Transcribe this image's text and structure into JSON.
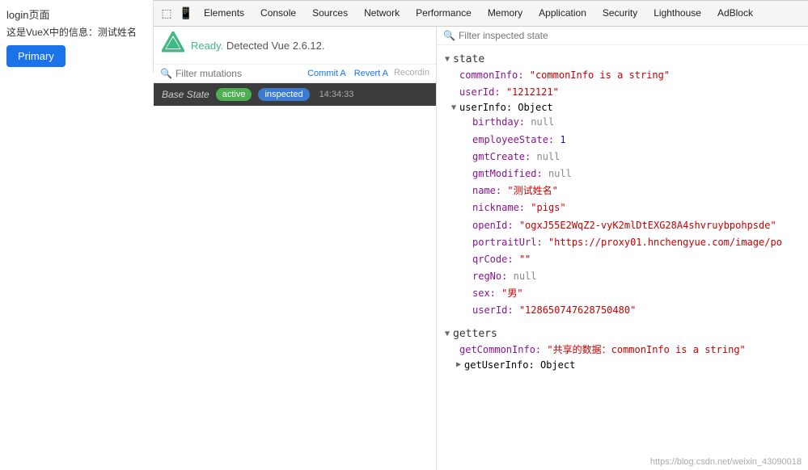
{
  "page": {
    "title": "login页面",
    "info": "这是VueX中的信息：测试姓名",
    "primary_btn": "Primary"
  },
  "devtools": {
    "tabs": [
      {
        "label": "Elements"
      },
      {
        "label": "Console"
      },
      {
        "label": "Sources"
      },
      {
        "label": "Network"
      },
      {
        "label": "Performance"
      },
      {
        "label": "Memory"
      },
      {
        "label": "Application"
      },
      {
        "label": "Security"
      },
      {
        "label": "Lighthouse"
      },
      {
        "label": "AdBlock"
      }
    ]
  },
  "vue": {
    "logo": "▶",
    "ready_text": "Ready. Detected Vue 2.6.12."
  },
  "mutations": {
    "filter_placeholder": "Filter mutations",
    "commit_label": "Commit A",
    "revert_label": "Revert A",
    "recording_label": "Recordin"
  },
  "state_bar": {
    "base_label": "Base State",
    "active_badge": "active",
    "inspected_badge": "inspected",
    "time": "14:34:33"
  },
  "right_panel": {
    "filter_placeholder": "Filter inspected state",
    "state_section": "state",
    "getters_section": "getters",
    "state_items": [
      {
        "key": "commonInfo:",
        "value": "\"commonInfo is a string\"",
        "type": "string"
      },
      {
        "key": "userId:",
        "value": "\"1212121\"",
        "type": "string"
      }
    ],
    "user_info": {
      "label": "userInfo: Object",
      "birthday": "null",
      "employeeState": "1",
      "gmtCreate": "null",
      "gmtModified": "null",
      "name": "\"测试姓名\"",
      "nickname": "\"pigs\"",
      "openId": "\"ogxJ55E2WqZ2-vyK2mlDtEXG28A4shvruybpohpsde\"",
      "portraitUrl": "\"https://proxy01.hnchengyue.com/image/po",
      "qrCode": "\"\"",
      "regNo": "null",
      "sex": "\"男\"",
      "userId": "\"128650747628750480\""
    },
    "getters_items": [
      {
        "key": "getCommonInfo:",
        "value": "\"共享的数据：commonInfo is a string\"",
        "type": "string"
      },
      {
        "key": "getUserInfo:",
        "value": "Object",
        "type": "object"
      }
    ]
  },
  "watermark": "https://blog.csdn.net/weixin_43090018"
}
